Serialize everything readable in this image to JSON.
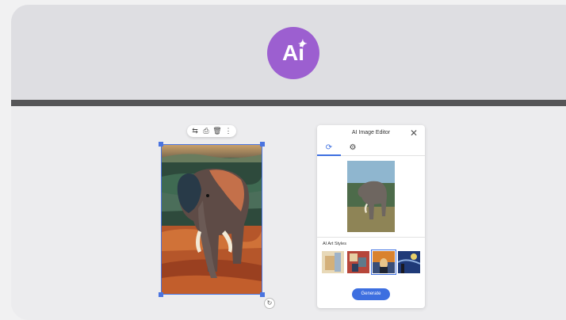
{
  "badge": {
    "text": "Ai",
    "spark": "✦"
  },
  "toolbar": {
    "icons": [
      "crop-icon",
      "lock-icon",
      "delete-icon",
      "more-icon"
    ]
  },
  "toolbar_glyphs": {
    "crop": "⇆",
    "lock": "⎙",
    "delete": "🗑",
    "more": "⋮"
  },
  "panel": {
    "title": "AI Image Editor",
    "close": "✕",
    "tabs": [
      {
        "icon": "⟳",
        "name": "restyle-tab"
      },
      {
        "icon": "⚙",
        "name": "settings-tab"
      }
    ],
    "styles_label": "AI Art Styles",
    "style_names": [
      "watercolor",
      "mosaic",
      "scream",
      "starry-night"
    ],
    "generate_label": "Generate"
  },
  "rotate_glyph": "↻",
  "colors": {
    "accent": "#3d6fe0",
    "badge": "#9c5fd0",
    "divider": "#555557"
  }
}
